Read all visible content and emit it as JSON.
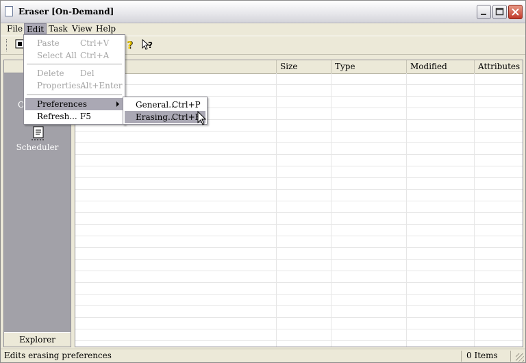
{
  "window": {
    "title": "Eraser  [On-Demand]"
  },
  "menubar": [
    "File",
    "Edit",
    "Task",
    "View",
    "Help"
  ],
  "edit_menu": {
    "items": [
      {
        "label": "Paste",
        "shortcut": "Ctrl+V",
        "disabled": true
      },
      {
        "label": "Select All",
        "shortcut": "Ctrl+A",
        "disabled": true
      },
      {
        "label": "Delete",
        "shortcut": "Del",
        "disabled": true
      },
      {
        "label": "Properties...",
        "shortcut": "Alt+Enter",
        "disabled": true
      },
      {
        "label": "Preferences",
        "shortcut": "",
        "disabled": false,
        "submenu": true
      },
      {
        "label": "Refresh...",
        "shortcut": "F5",
        "disabled": false
      }
    ]
  },
  "preferences_submenu": [
    {
      "label": "General...",
      "shortcut": "Ctrl+P"
    },
    {
      "label": "Erasing...",
      "shortcut": "Ctrl+E"
    }
  ],
  "sidebar": {
    "on_demand_label": "O",
    "scheduler_label": "Scheduler",
    "explorer_label": "Explorer"
  },
  "columns": [
    "",
    "Size",
    "Type",
    "Modified",
    "Attributes"
  ],
  "status": {
    "text": "Edits erasing preferences",
    "count": "0 Items"
  },
  "colors": {
    "highlight": "#aaa8b4",
    "sidebar": "#a2a1a8",
    "close": "#c0392b"
  }
}
